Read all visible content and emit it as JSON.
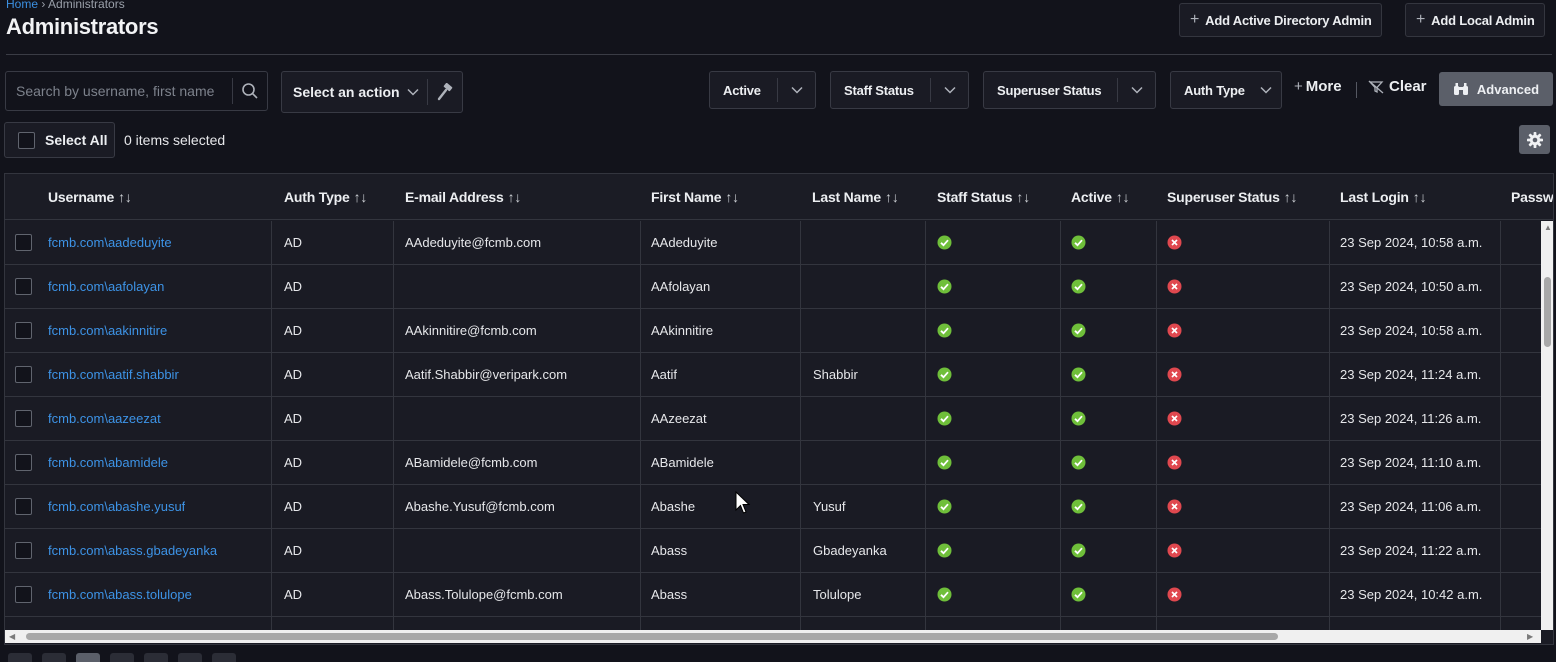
{
  "breadcrumb": {
    "home": "Home",
    "sep": "›",
    "current": "Administrators"
  },
  "page": {
    "title": "Administrators"
  },
  "header_buttons": {
    "add_ad_admin": "Add Active Directory Admin",
    "add_local_admin": "Add Local Admin"
  },
  "search": {
    "placeholder": "Search by username, first name"
  },
  "action_select": {
    "label": "Select an action"
  },
  "filters": {
    "active": "Active",
    "staff_status": "Staff Status",
    "superuser_status": "Superuser Status",
    "auth_type": "Auth Type",
    "more": "More",
    "clear": "Clear",
    "advanced": "Advanced"
  },
  "selection": {
    "select_all": "Select All",
    "count_text": "0 items selected"
  },
  "table": {
    "columns": [
      "Username",
      "Auth Type",
      "E-mail Address",
      "First Name",
      "Last Name",
      "Staff Status",
      "Active",
      "Superuser Status",
      "Last Login",
      "Passw"
    ],
    "rows": [
      {
        "username": "fcmb.com\\aadeduyite",
        "auth_type": "AD",
        "email": "AAdeduyite@fcmb.com",
        "first_name": "AAdeduyite",
        "last_name": "",
        "staff": true,
        "active": true,
        "superuser": false,
        "last_login": "23 Sep 2024, 10:58 a.m."
      },
      {
        "username": "fcmb.com\\aafolayan",
        "auth_type": "AD",
        "email": "",
        "first_name": "AAfolayan",
        "last_name": "",
        "staff": true,
        "active": true,
        "superuser": false,
        "last_login": "23 Sep 2024, 10:50 a.m."
      },
      {
        "username": "fcmb.com\\aakinnitire",
        "auth_type": "AD",
        "email": "AAkinnitire@fcmb.com",
        "first_name": "AAkinnitire",
        "last_name": "",
        "staff": true,
        "active": true,
        "superuser": false,
        "last_login": "23 Sep 2024, 10:58 a.m."
      },
      {
        "username": "fcmb.com\\aatif.shabbir",
        "auth_type": "AD",
        "email": "Aatif.Shabbir@veripark.com",
        "first_name": "Aatif",
        "last_name": "Shabbir",
        "staff": true,
        "active": true,
        "superuser": false,
        "last_login": "23 Sep 2024, 11:24 a.m."
      },
      {
        "username": "fcmb.com\\aazeezat",
        "auth_type": "AD",
        "email": "",
        "first_name": "AAzeezat",
        "last_name": "",
        "staff": true,
        "active": true,
        "superuser": false,
        "last_login": "23 Sep 2024, 11:26 a.m."
      },
      {
        "username": "fcmb.com\\abamidele",
        "auth_type": "AD",
        "email": "ABamidele@fcmb.com",
        "first_name": "ABamidele",
        "last_name": "",
        "staff": true,
        "active": true,
        "superuser": false,
        "last_login": "23 Sep 2024, 11:10 a.m."
      },
      {
        "username": "fcmb.com\\abashe.yusuf",
        "auth_type": "AD",
        "email": "Abashe.Yusuf@fcmb.com",
        "first_name": "Abashe",
        "last_name": "Yusuf",
        "staff": true,
        "active": true,
        "superuser": false,
        "last_login": "23 Sep 2024, 11:06 a.m."
      },
      {
        "username": "fcmb.com\\abass.gbadeyanka",
        "auth_type": "AD",
        "email": "",
        "first_name": "Abass",
        "last_name": "Gbadeyanka",
        "staff": true,
        "active": true,
        "superuser": false,
        "last_login": "23 Sep 2024, 11:22 a.m."
      },
      {
        "username": "fcmb.com\\abass.tolulope",
        "auth_type": "AD",
        "email": "Abass.Tolulope@fcmb.com",
        "first_name": "Abass",
        "last_name": "Tolulope",
        "staff": true,
        "active": true,
        "superuser": false,
        "last_login": "23 Sep 2024, 10:42 a.m."
      }
    ]
  },
  "icons": {
    "search": "search-icon",
    "hammer": "hammer-icon",
    "gear": "gear-icon",
    "check": "check-circle-icon",
    "cross": "x-circle-icon"
  },
  "colors": {
    "link": "#3d93e6",
    "check": "#6fbf3a",
    "cross": "#e0484f",
    "advanced_bg": "#5b5f69"
  }
}
